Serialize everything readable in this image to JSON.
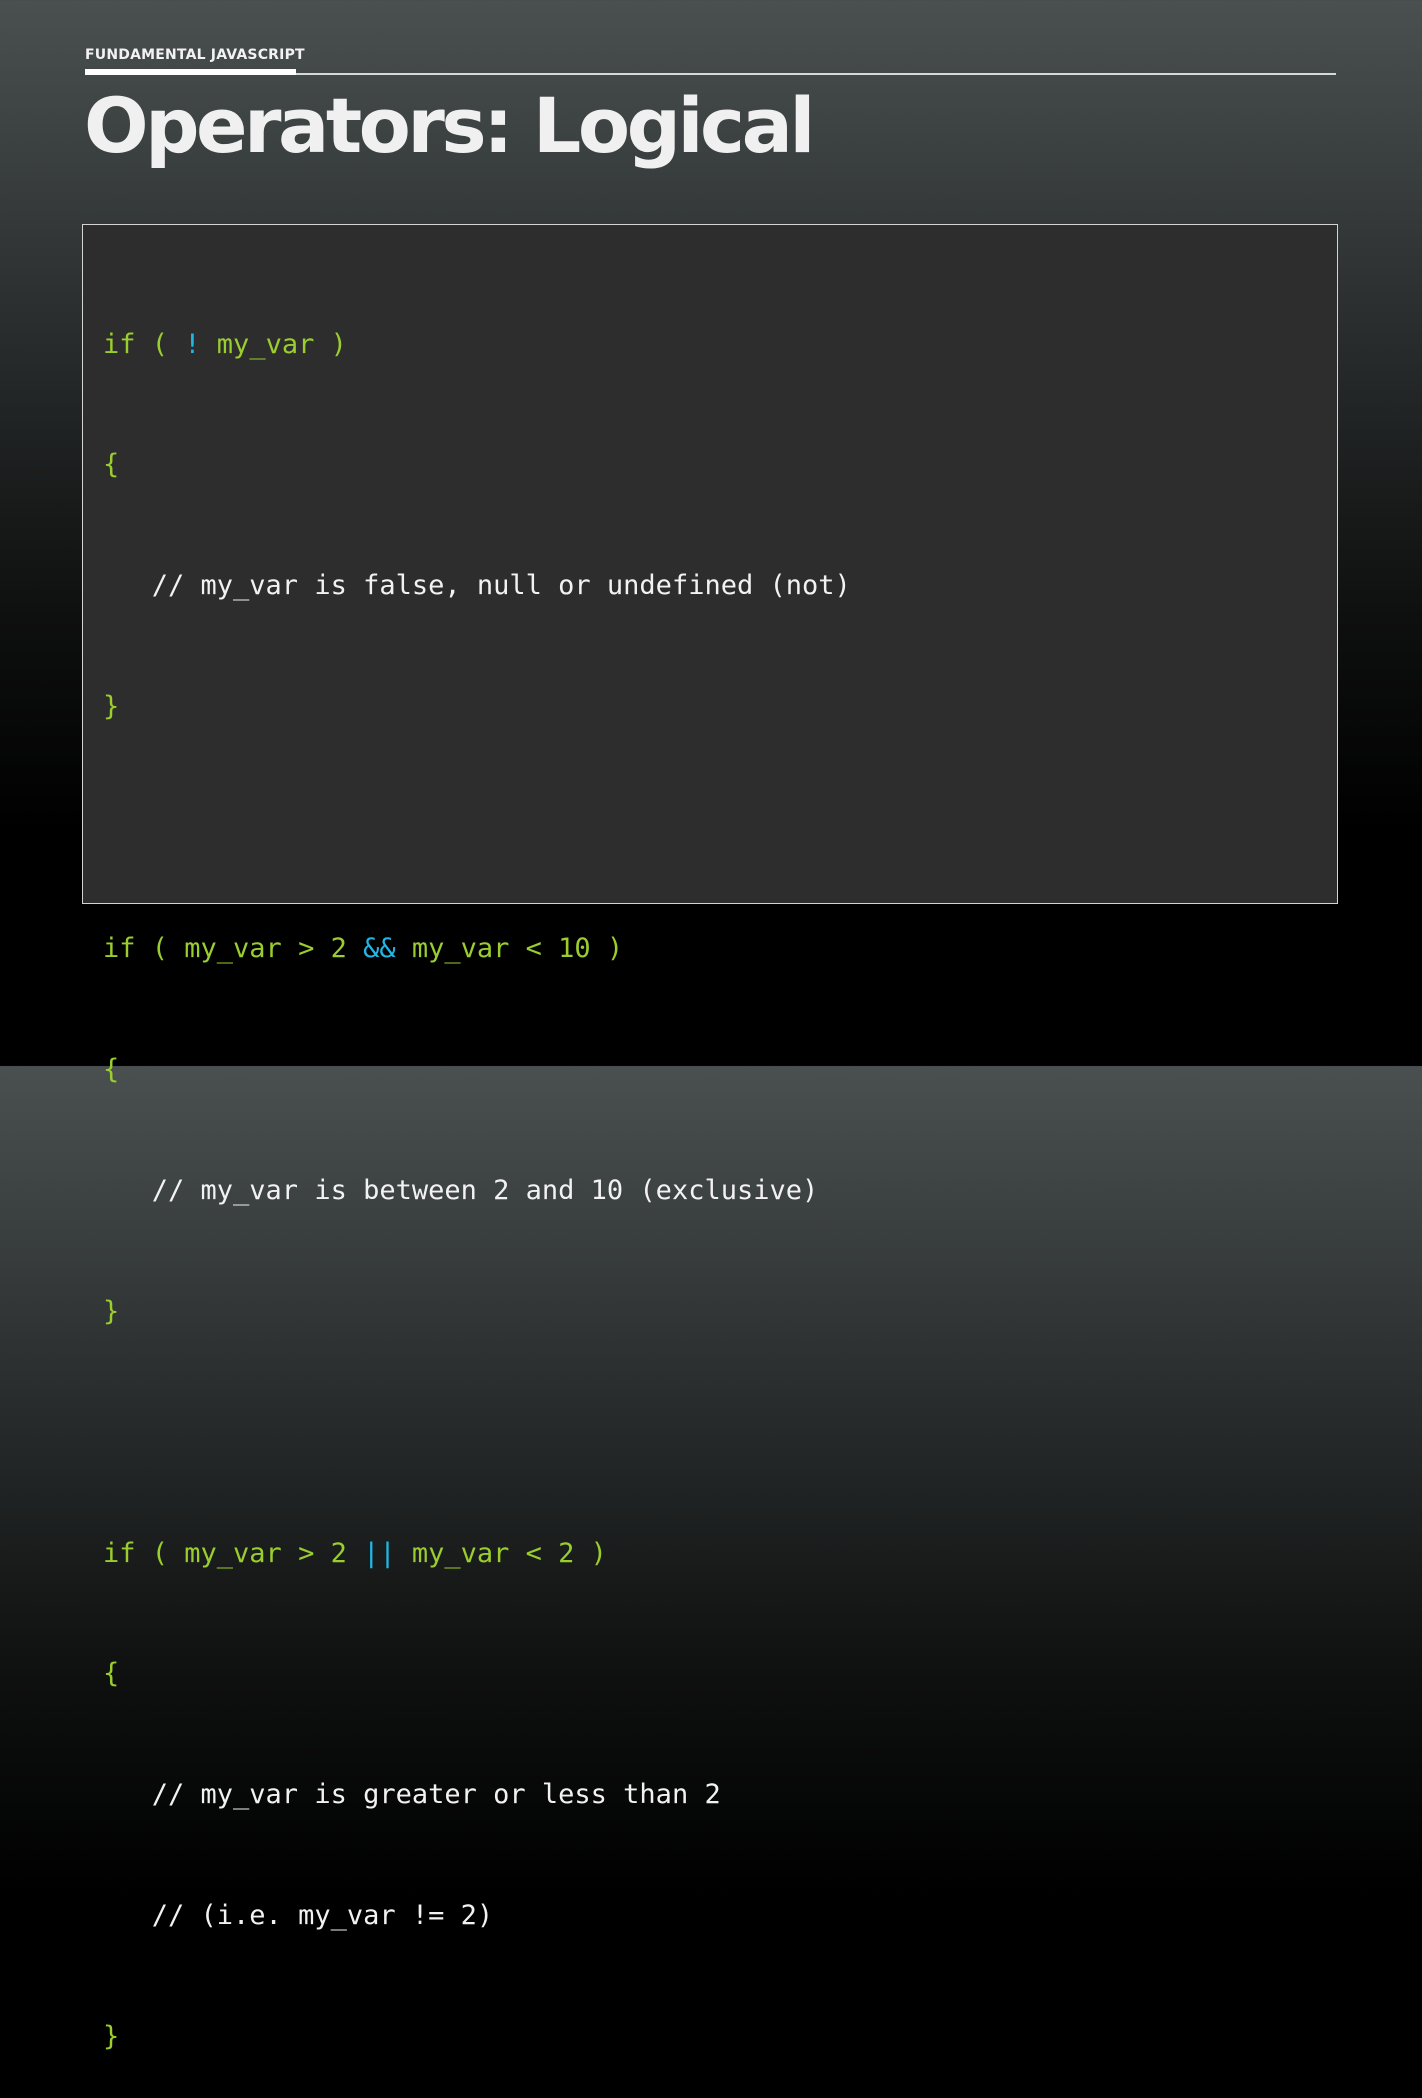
{
  "header": {
    "section_label": "FUNDAMENTAL JAVASCRIPT",
    "title": "Operators: Logical"
  },
  "colors": {
    "code_green": "#9acd2e",
    "operator_cyan": "#1fb7e6",
    "comment_white": "#f2f2f2",
    "code_background": "#2d2d2d"
  },
  "code": {
    "block1": {
      "if_open": "if ( ",
      "op": "!",
      "if_close": " my_var )",
      "brace_open": "{",
      "comment1": "   // my_var is false, null or undefined (not)",
      "brace_close": "}"
    },
    "block2": {
      "if_open": "if ( my_var > 2 ",
      "op": "&&",
      "if_close": " my_var < 10 )",
      "brace_open": "{",
      "comment1": "   // my_var is between 2 and 10 (exclusive)",
      "brace_close": "}"
    },
    "block3": {
      "if_open": "if ( my_var > 2 ",
      "op": "||",
      "if_close": " my_var < 2 )",
      "brace_open": "{",
      "comment1": "   // my_var is greater or less than 2",
      "comment2": "   // (i.e. my_var != 2)",
      "brace_close": "}"
    }
  }
}
